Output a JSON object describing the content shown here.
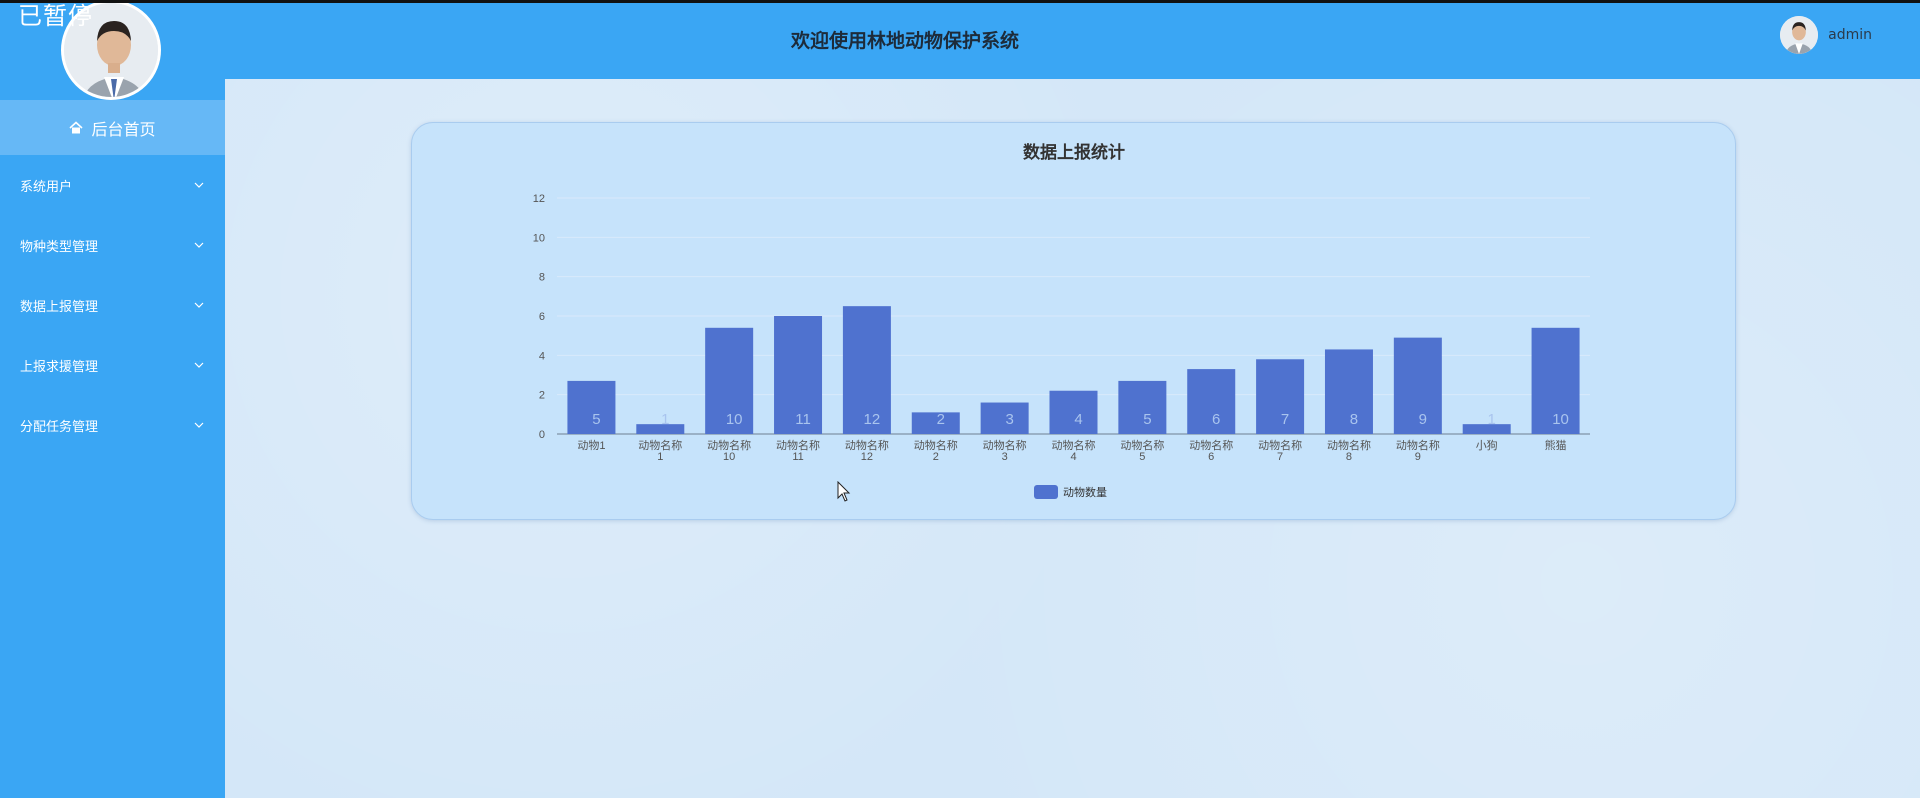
{
  "overlay": {
    "text": "已暂停"
  },
  "header": {
    "title": "欢迎使用林地动物保护系统",
    "username": "admin"
  },
  "sidebar": {
    "home_label": "后台首页",
    "items": [
      {
        "label": "系统用户"
      },
      {
        "label": "物种类型管理"
      },
      {
        "label": "数据上报管理"
      },
      {
        "label": "上报求援管理"
      },
      {
        "label": "分配任务管理"
      }
    ]
  },
  "colors": {
    "sidebar": "#3aa6f4",
    "home_active": "#66b8f6",
    "bar": "#4f72cf",
    "card": "#c6e3fb"
  },
  "chart_data": {
    "type": "bar",
    "title": "数据上报统计",
    "categories": [
      "动物1",
      "动物名称1",
      "动物名称10",
      "动物名称11",
      "动物名称12",
      "动物名称2",
      "动物名称3",
      "动物名称4",
      "动物名称5",
      "动物名称6",
      "动物名称7",
      "动物名称8",
      "动物名称9",
      "小狗",
      "熊猫"
    ],
    "category_lines": [
      [
        "动物1"
      ],
      [
        "动物名称",
        "1"
      ],
      [
        "动物名称",
        "10"
      ],
      [
        "动物名称",
        "11"
      ],
      [
        "动物名称",
        "12"
      ],
      [
        "动物名称",
        "2"
      ],
      [
        "动物名称",
        "3"
      ],
      [
        "动物名称",
        "4"
      ],
      [
        "动物名称",
        "5"
      ],
      [
        "动物名称",
        "6"
      ],
      [
        "动物名称",
        "7"
      ],
      [
        "动物名称",
        "8"
      ],
      [
        "动物名称",
        "9"
      ],
      [
        "小狗"
      ],
      [
        "熊猫"
      ]
    ],
    "series": [
      {
        "name": "动物数量",
        "values": [
          2.7,
          0.5,
          5.4,
          6.0,
          6.5,
          1.1,
          1.6,
          2.2,
          2.7,
          3.3,
          3.8,
          4.3,
          4.9,
          0.5,
          5.4
        ]
      }
    ],
    "data_labels": [
      "5",
      "1",
      "10",
      "11",
      "12",
      "2",
      "3",
      "4",
      "5",
      "6",
      "7",
      "8",
      "9",
      "1",
      "10"
    ],
    "yticks": [
      "0",
      "2",
      "4",
      "6",
      "8",
      "10",
      "12"
    ],
    "ylim": [
      0,
      12
    ],
    "legend": "bottom-center",
    "grid": true
  }
}
